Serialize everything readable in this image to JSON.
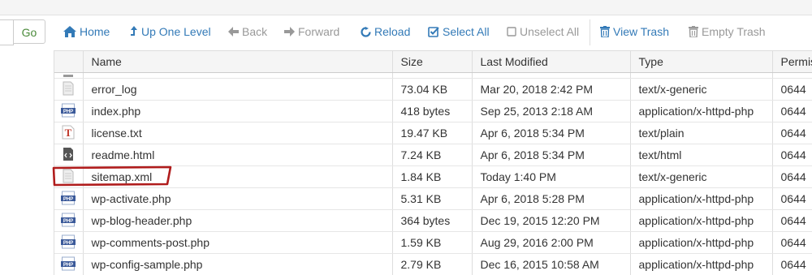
{
  "toolbar": {
    "go_label": "Go",
    "home_label": "Home",
    "up_label": "Up One Level",
    "back_label": "Back",
    "forward_label": "Forward",
    "reload_label": "Reload",
    "select_all_label": "Select All",
    "unselect_all_label": "Unselect All",
    "view_trash_label": "View Trash",
    "empty_trash_label": "Empty Trash"
  },
  "table": {
    "headers": {
      "name": "Name",
      "size": "Size",
      "modified": "Last Modified",
      "type": "Type",
      "perms": "Permis"
    },
    "rows": [
      {
        "icon": "generic-file-icon",
        "name": "error_log",
        "size": "73.04 KB",
        "modified": "Mar 20, 2018 2:42 PM",
        "type": "text/x-generic",
        "perms": "0644"
      },
      {
        "icon": "php-file-icon",
        "name": "index.php",
        "size": "418 bytes",
        "modified": "Sep 25, 2013 2:18 AM",
        "type": "application/x-httpd-php",
        "perms": "0644"
      },
      {
        "icon": "text-file-icon",
        "name": "license.txt",
        "size": "19.47 KB",
        "modified": "Apr 6, 2018 5:34 PM",
        "type": "text/plain",
        "perms": "0644"
      },
      {
        "icon": "html-file-icon",
        "name": "readme.html",
        "size": "7.24 KB",
        "modified": "Apr 6, 2018 5:34 PM",
        "type": "text/html",
        "perms": "0644"
      },
      {
        "icon": "generic-file-icon",
        "name": "sitemap.xml",
        "size": "1.84 KB",
        "modified": "Today 1:40 PM",
        "type": "text/x-generic",
        "perms": "0644"
      },
      {
        "icon": "php-file-icon",
        "name": "wp-activate.php",
        "size": "5.31 KB",
        "modified": "Apr 6, 2018 5:28 PM",
        "type": "application/x-httpd-php",
        "perms": "0644"
      },
      {
        "icon": "php-file-icon",
        "name": "wp-blog-header.php",
        "size": "364 bytes",
        "modified": "Dec 19, 2015 12:20 PM",
        "type": "application/x-httpd-php",
        "perms": "0644"
      },
      {
        "icon": "php-file-icon",
        "name": "wp-comments-post.php",
        "size": "1.59 KB",
        "modified": "Aug 29, 2016 2:00 PM",
        "type": "application/x-httpd-php",
        "perms": "0644"
      },
      {
        "icon": "php-file-icon",
        "name": "wp-config-sample.php",
        "size": "2.79 KB",
        "modified": "Dec 16, 2015 10:58 AM",
        "type": "application/x-httpd-php",
        "perms": "0644"
      }
    ]
  },
  "colors": {
    "link": "#337ab7",
    "disabled": "#999999",
    "highlight": "#b01c1c",
    "go": "#4a8a3a"
  }
}
